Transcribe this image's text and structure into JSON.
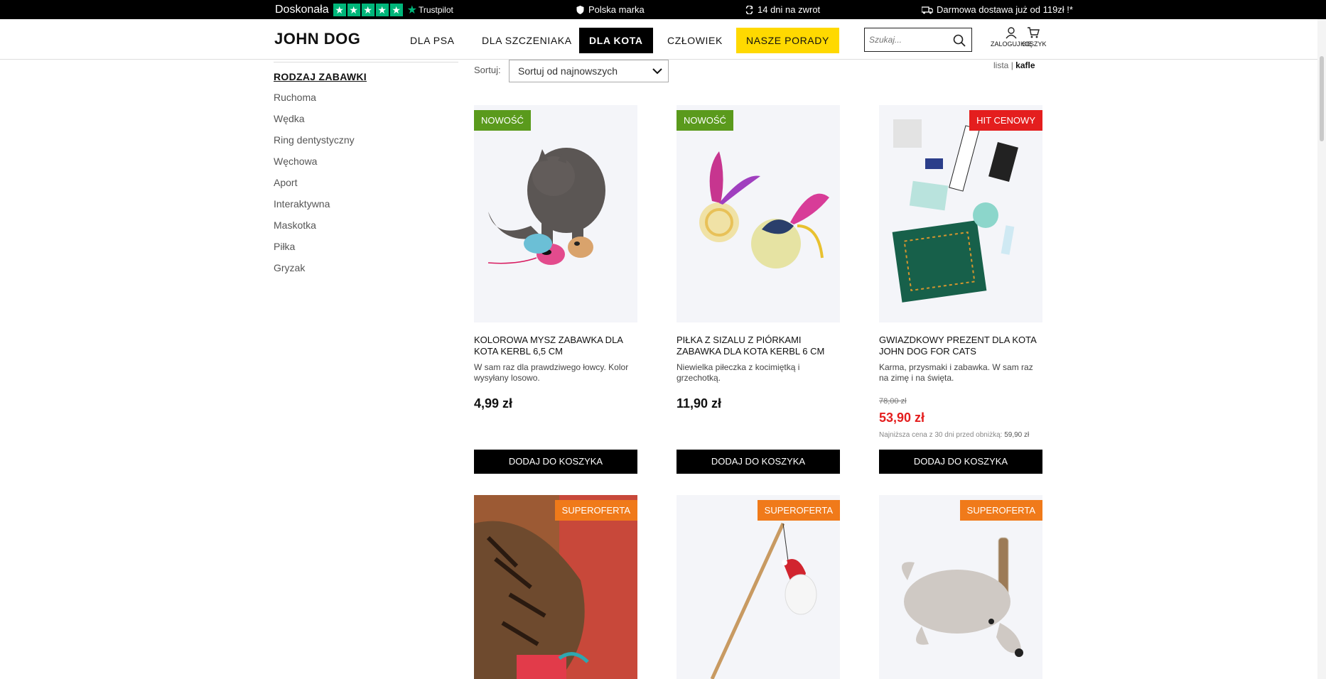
{
  "topbar": {
    "trustpilot_rating": "Doskonała",
    "trustpilot_brand": "Trustpilot",
    "items": [
      "Polska marka",
      "14 dni na zwrot",
      "Darmowa dostawa już od 119zł !*"
    ]
  },
  "header": {
    "logo": "JOHN DOG",
    "nav": [
      "DLA PSA",
      "DLA SZCZENIAKA",
      "DLA KOTA",
      "CZŁOWIEK",
      "NASZE PORADY"
    ],
    "active_nav": "DLA KOTA",
    "search_placeholder": "Szukaj...",
    "login_label": "ZALOGUJ SIĘ",
    "cart_label": "KOSZYK"
  },
  "sidebar": {
    "title": "RODZAJ ZABAWKI",
    "items": [
      "Ruchoma",
      "Wędka",
      "Ring dentystyczny",
      "Węchowa",
      "Aport",
      "Interaktywna",
      "Maskotka",
      "Piłka",
      "Gryzak"
    ]
  },
  "toolbar": {
    "sort_label": "Sortuj:",
    "sort_value": "Sortuj od najnowszych",
    "view_list": "lista",
    "view_separator": "|",
    "view_tiles": "kafle"
  },
  "products": [
    {
      "badge": "NOWOŚĆ",
      "name": "KOLOROWA MYSZ ZABAWKA DLA KOTA KERBL 6,5 CM",
      "desc": "W sam raz dla prawdziwego łowcy. Kolor wysyłany losowo.",
      "price": "4,99 zł",
      "button": "DODAJ DO KOSZYKA"
    },
    {
      "badge": "NOWOŚĆ",
      "name": "PIŁKA Z SIZALU Z PIÓRKAMI ZABAWKA DLA KOTA KERBL 6 CM",
      "desc": "Niewielka piłeczka z kocimiętką i grzechotką.",
      "price": "11,90 zł",
      "button": "DODAJ DO KOSZYKA"
    },
    {
      "badge": "HIT CENOWY",
      "name": "GWIAZDKOWY PREZENT DLA KOTA JOHN DOG FOR CATS",
      "desc": "Karma, przysmaki i zabawka. W sam raz na zimę i na święta.",
      "old_price": "78,00 zł",
      "sale_price": "53,90 zł",
      "lowest_label": "Najniższa cena z 30 dni przed obniżką:",
      "lowest_value": "59,90 zł",
      "button": "DODAJ DO KOSZYKA"
    },
    {
      "badge": "SUPEROFERTA"
    },
    {
      "badge": "SUPEROFERTA"
    },
    {
      "badge": "SUPEROFERTA"
    }
  ],
  "colors": {
    "accent_yellow": "#ffd900",
    "badge_new": "#5a9a1c",
    "badge_hit": "#e41e1e",
    "badge_super": "#f07a1a",
    "trustpilot_green": "#00b67a"
  }
}
